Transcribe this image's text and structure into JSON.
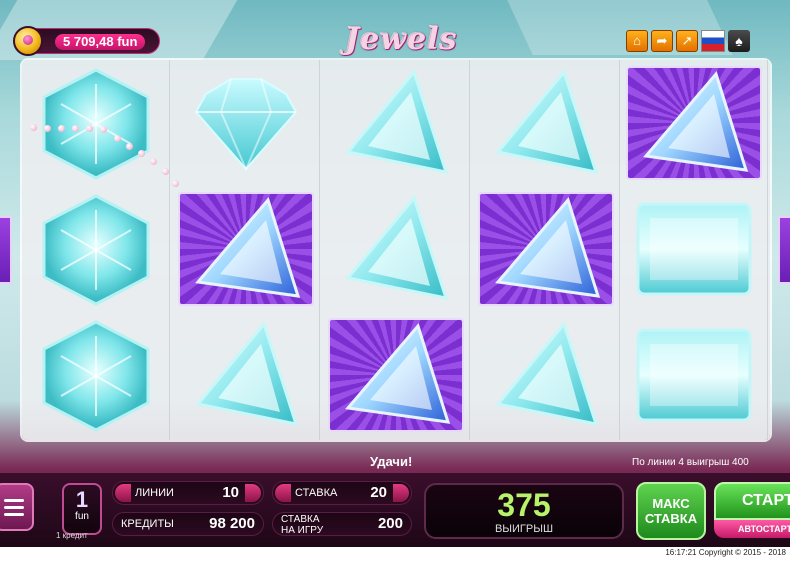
{
  "balance": {
    "text": "5 709,48 fun"
  },
  "logo": {
    "text": "Jewels"
  },
  "top_icons": [
    {
      "name": "home-icon",
      "glyph": "⌂"
    },
    {
      "name": "back-icon",
      "glyph": "➦"
    },
    {
      "name": "external-icon",
      "glyph": "↗"
    }
  ],
  "reels": [
    [
      "hexagon-gem",
      "hexagon-gem",
      "hexagon-gem"
    ],
    [
      "diamond-gem",
      "triangle-purple",
      "triangle-gem"
    ],
    [
      "triangle-gem",
      "triangle-gem",
      "triangle-purple"
    ],
    [
      "triangle-gem",
      "triangle-purple",
      "triangle-gem"
    ],
    [
      "triangle-purple",
      "square-gem",
      "square-gem"
    ]
  ],
  "messages": {
    "good_luck": "Удачи!",
    "line_win": "По линии 4 выигрыш 400"
  },
  "panel": {
    "credit_value": "1",
    "credit_unit": "fun",
    "credit_sub": "1 кредит",
    "lines_label": "ЛИНИИ",
    "lines_value": "10",
    "credits_label": "КРЕДИТЫ",
    "credits_value": "98 200",
    "bet_label": "СТАВКА",
    "bet_value": "20",
    "total_bet_label_1": "СТАВКА",
    "total_bet_label_2": "НА ИГРУ",
    "total_bet_value": "200",
    "win_value": "375",
    "win_label": "ВЫИГРЫШ",
    "max_bet_label_1": "МАКС",
    "max_bet_label_2": "СТАВКА",
    "start_label": "СТАРТ",
    "auto_label": "АВТОСТАРТ"
  },
  "footer": {
    "text": "16:17:21   Copyright ©  2015 - 2018"
  },
  "colors": {
    "accent": "#c5146a",
    "win": "#b8f26a",
    "start": "#21931c"
  }
}
